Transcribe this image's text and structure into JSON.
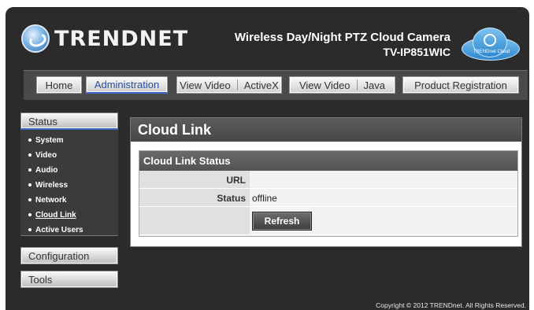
{
  "header": {
    "brand": "TRENDNET",
    "product_name": "Wireless Day/Night PTZ Cloud Camera",
    "model": "TV-IP851WIC",
    "cloud_badge": "TRENDnet Cloud"
  },
  "nav": {
    "home": "Home",
    "administration": "Administration",
    "view_video_activex_a": "View Video",
    "view_video_activex_b": "ActiveX",
    "view_video_java_a": "View Video",
    "view_video_java_b": "Java",
    "product_registration": "Product Registration"
  },
  "sidebar": {
    "status_header": "Status",
    "items": [
      {
        "label": "System"
      },
      {
        "label": "Video"
      },
      {
        "label": "Audio"
      },
      {
        "label": "Wireless"
      },
      {
        "label": "Network"
      },
      {
        "label": "Cloud Link"
      },
      {
        "label": "Active Users"
      }
    ],
    "configuration_header": "Configuration",
    "tools_header": "Tools"
  },
  "main": {
    "title": "Cloud Link",
    "panel_title": "Cloud Link Status",
    "url_label": "URL",
    "url_value": "",
    "status_label": "Status",
    "status_value": "offline",
    "refresh_label": "Refresh"
  },
  "footer": {
    "copyright": "Copyright © 2012 TRENDnet.  All Rights Reserved."
  }
}
